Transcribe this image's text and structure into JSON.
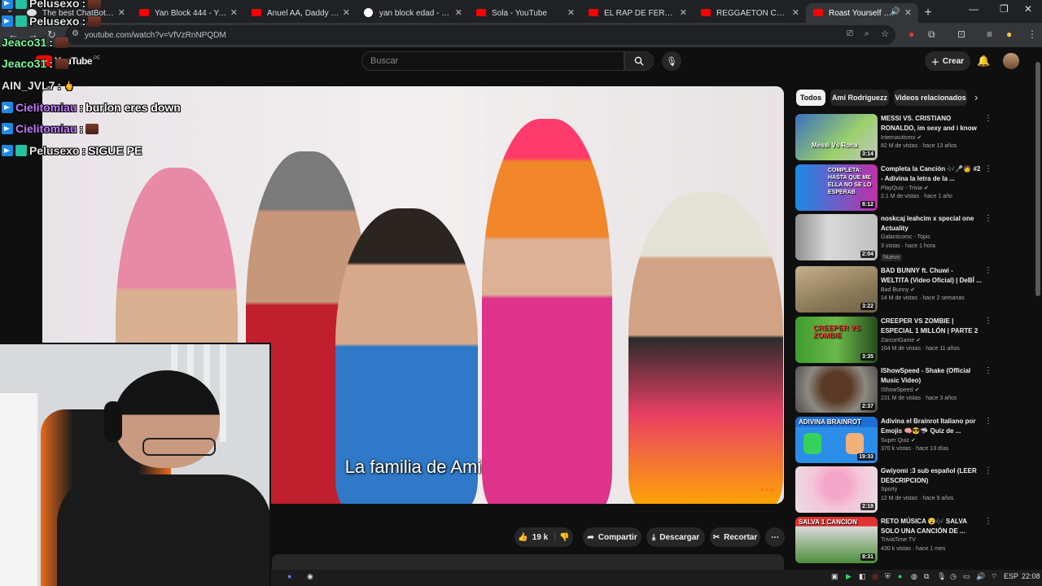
{
  "browser": {
    "tabs": [
      {
        "label": "The best ChatBot and W",
        "icon": "chatbot-icon"
      },
      {
        "label": "Yan Block 444 - YouTube",
        "icon": "youtube-icon"
      },
      {
        "label": "Anuel AA, Daddy Yankee",
        "icon": "youtube-icon"
      },
      {
        "label": "yan block edad - Buscar c",
        "icon": "google-icon"
      },
      {
        "label": "Sola - YouTube",
        "icon": "youtube-icon"
      },
      {
        "label": "EL RAP DE FERNANFLOO",
        "icon": "youtube-icon"
      },
      {
        "label": "REGGAETON CHAMPAGNE",
        "icon": "youtube-icon"
      },
      {
        "label": "Roast Yourself Casero",
        "icon": "youtube-icon",
        "active": true
      }
    ],
    "url": "youtube.com/watch?v=VfVzRnNPQDM"
  },
  "youtube": {
    "logo_text": "YouTube",
    "country_code": "PE",
    "search_placeholder": "Buscar",
    "create_label": "Crear"
  },
  "video": {
    "subtitle": "La familia de Ami",
    "like_count": "19 k",
    "share_label": "Compartir",
    "download_label": "Descargar",
    "clip_label": "Recortar"
  },
  "sidebar": {
    "chips": [
      "Todos",
      "Ami Rodriguezz",
      "Videos relacionados"
    ],
    "videos": [
      {
        "title": "MESSI VS. CRISTIANO RONALDO, im sexy and i know ...",
        "channel": "Internautismo",
        "verified": true,
        "meta": "82 M de vistas · hace 13 años",
        "duration": "3:14",
        "thumb_text": "Messi Vs Rona",
        "badge": ""
      },
      {
        "title": "Completa la Canción 🎶🎤🧑 #2 - Adivina la letra de la ...",
        "channel": "PlayQuiz - Trivia",
        "verified": true,
        "meta": "2.1 M de vistas · hace 1 año",
        "duration": "8:12",
        "thumb_text": "COMPLETA: HASTA QUE ME ELLA NO SE LO ESPERAB",
        "badge": ""
      },
      {
        "title": "noskcaj leahcim x special one Actuality",
        "channel": "Galacticomc - Topic",
        "verified": false,
        "meta": "3 vistas · hace 1 hora",
        "duration": "2:04",
        "thumb_text": "",
        "badge": "Nuevo"
      },
      {
        "title": "BAD BUNNY ft. Chuwi - WELTITA (Video Oficial) | DeBÍ ...",
        "channel": "Bad Bunny",
        "verified": true,
        "meta": "14 M de vistas · hace 2 semanas",
        "duration": "3:22",
        "thumb_text": "",
        "badge": ""
      },
      {
        "title": "CREEPER VS ZOMBIE | ESPECIAL 1 MILLÓN | PARTE 2",
        "channel": "ZarcortGame",
        "verified": true,
        "meta": "164 M de vistas · hace 11 años",
        "duration": "3:35",
        "thumb_text": "CREEPER VS ZOMBIE",
        "badge": ""
      },
      {
        "title": "IShowSpeed - Shake (Official Music Video)",
        "channel": "IShowSpeed",
        "verified": true,
        "meta": "231 M de vistas · hace 3 años",
        "duration": "2:37",
        "thumb_text": "",
        "badge": ""
      },
      {
        "title": "Adivina el Brainrot Italiano por Emojis 🧠😎🦈 Quiz de ...",
        "channel": "Super Quiz",
        "verified": true,
        "meta": "370 k vistas · hace 13 días",
        "duration": "19:33",
        "thumb_text": "ADIVINA BRAINROT",
        "badge": ""
      },
      {
        "title": "Gwiyomi :3 sub español (LEER DESCRIPCION)",
        "channel": "Sporty",
        "verified": false,
        "meta": "12 M de vistas · hace 9 años",
        "duration": "2:19",
        "thumb_text": "",
        "badge": ""
      },
      {
        "title": "RETO MÚSICA 😮🎶 SALVA SOLO UNA CANCIÓN DE ...",
        "channel": "TriviaTime TV",
        "verified": false,
        "meta": "430 k vistas · hace 1 mes",
        "duration": "8:31",
        "thumb_text": "SALVA 1 CANCION",
        "badge": ""
      }
    ]
  },
  "chat": [
    {
      "user": "Pelusexo",
      "text": "",
      "emote": true
    },
    {
      "user": "Jeaco31",
      "text": "",
      "emote": true
    },
    {
      "user": "AIN_JVL7",
      "text": "",
      "emote": true
    },
    {
      "user": "Cielitomiau",
      "text": "burlon eres down",
      "emote": false
    },
    {
      "user": "Cielitomiau",
      "text": "",
      "emote": true
    },
    {
      "user": "Pelusexo",
      "text": "SIGUE PE",
      "emote": false
    }
  ],
  "taskbar": {
    "language": "ESP",
    "time": "22:08"
  },
  "colors": {
    "youtube_red": "#ff0000",
    "bg": "#0f0f0f",
    "chip_bg": "#272727",
    "chat_name_purple": "#c37cff"
  }
}
